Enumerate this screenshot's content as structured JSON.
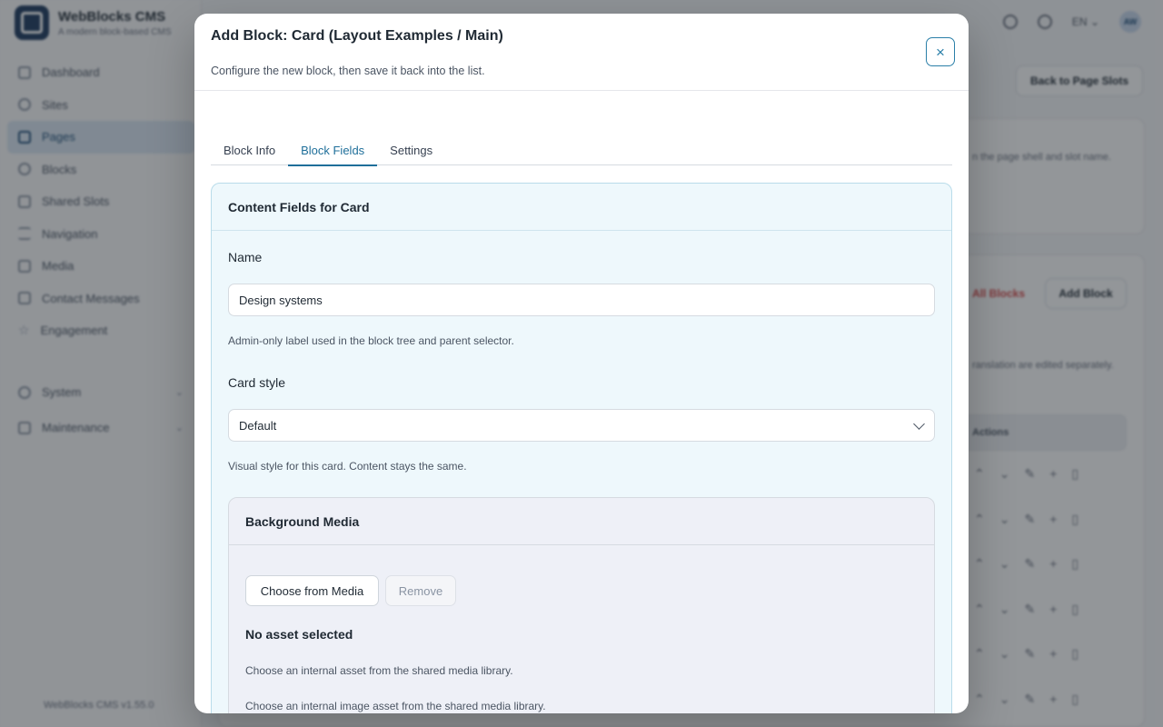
{
  "app": {
    "brand_title": "WebBlocks CMS",
    "brand_subtitle": "A modern block-based CMS",
    "version": "WebBlocks CMS v1.55.0",
    "language": "EN",
    "avatar_initials": "AW"
  },
  "sidebar": {
    "items": [
      {
        "label": "Dashboard",
        "icon": "grid-icon"
      },
      {
        "label": "Sites",
        "icon": "globe-icon"
      },
      {
        "label": "Pages",
        "icon": "page-icon"
      },
      {
        "label": "Blocks",
        "icon": "blocks-icon"
      },
      {
        "label": "Shared Slots",
        "icon": "layers-icon"
      },
      {
        "label": "Navigation",
        "icon": "menu-icon"
      },
      {
        "label": "Media",
        "icon": "image-icon"
      },
      {
        "label": "Contact Messages",
        "icon": "mail-icon"
      },
      {
        "label": "Engagement",
        "icon": "star-icon"
      }
    ],
    "groups": [
      {
        "label": "System",
        "icon": "gear-icon"
      },
      {
        "label": "Maintenance",
        "icon": "wrench-icon"
      }
    ]
  },
  "background": {
    "back_button": "Back to Page Slots",
    "hint_text": "n the page shell and slot name.",
    "all_blocks_link": "All Blocks",
    "add_block_button": "Add Block",
    "translation_text": "ranslation are edited separately.",
    "actions_header": "Actions"
  },
  "modal": {
    "title": "Add Block: Card (Layout Examples / Main)",
    "subtitle": "Configure the new block, then save it back into the list.",
    "close_symbol": "×",
    "tabs": [
      {
        "label": "Block Info"
      },
      {
        "label": "Block Fields"
      },
      {
        "label": "Settings"
      }
    ],
    "fields_title": "Content Fields for Card",
    "name_label": "Name",
    "name_value": "Design systems",
    "name_help": "Admin-only label used in the block tree and parent selector.",
    "style_label": "Card style",
    "style_value": "Default",
    "style_help": "Visual style for this card. Content stays the same.",
    "media": {
      "title": "Background Media",
      "choose_button": "Choose from Media",
      "remove_button": "Remove",
      "no_asset": "No asset selected",
      "help_1": "Choose an internal asset from the shared media library.",
      "help_2": "Choose an internal image asset from the shared media library."
    }
  }
}
